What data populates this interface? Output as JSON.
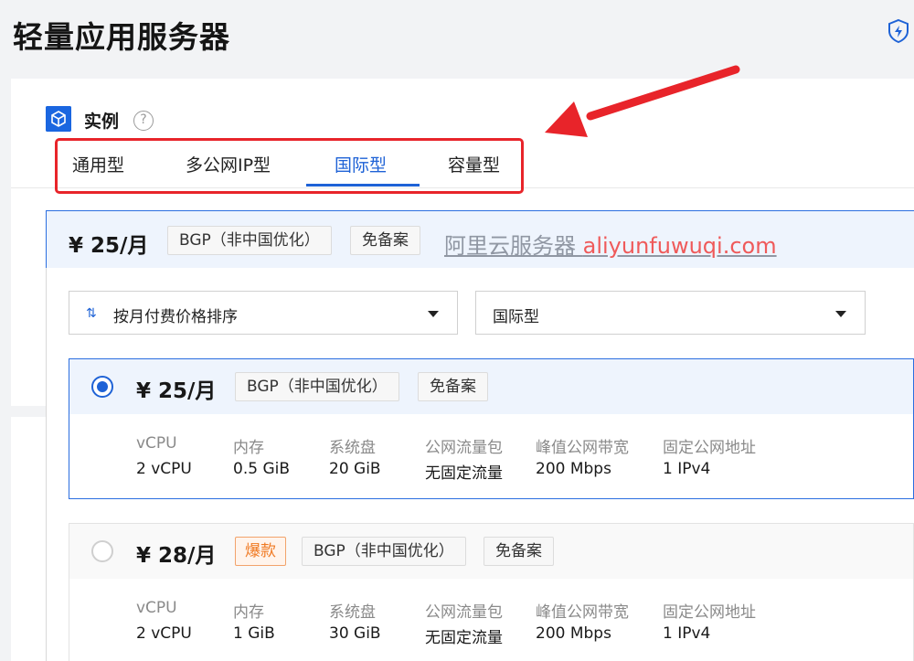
{
  "page": {
    "title": "轻量应用服务器"
  },
  "instance": {
    "title": "实例",
    "help": "?"
  },
  "tabs": [
    "通用型",
    "多公网IP型",
    "国际型",
    "容量型"
  ],
  "active_tab": "国际型",
  "summary": {
    "price": "¥ 25/月",
    "tags": [
      "BGP（非中国优化）",
      "免备案"
    ],
    "watermark_text": "阿里云服务器",
    "watermark_url": "aliyunfuwuqi.com"
  },
  "filters": {
    "sort": {
      "icon": "sort-icon",
      "label": "按月付费价格排序"
    },
    "type": {
      "label": "国际型"
    }
  },
  "spec_headers": [
    "vCPU",
    "内存",
    "系统盘",
    "公网流量包",
    "峰值公网带宽",
    "固定公网地址"
  ],
  "plans": [
    {
      "selected": true,
      "price": "¥ 25/月",
      "hot": "",
      "tags": [
        "BGP（非中国优化）",
        "免备案"
      ],
      "specs": [
        "2 vCPU",
        "0.5 GiB",
        "20 GiB",
        "无固定流量",
        "200 Mbps",
        "1 IPv4"
      ]
    },
    {
      "selected": false,
      "price": "¥ 28/月",
      "hot": "爆款",
      "tags": [
        "BGP（非中国优化）",
        "免备案"
      ],
      "specs": [
        "2 vCPU",
        "1 GiB",
        "30 GiB",
        "无固定流量",
        "200 Mbps",
        "1 IPv4"
      ]
    }
  ],
  "colors": {
    "accent": "#1e62d6",
    "annotation": "#e8242a",
    "hot": "#f07a23"
  }
}
